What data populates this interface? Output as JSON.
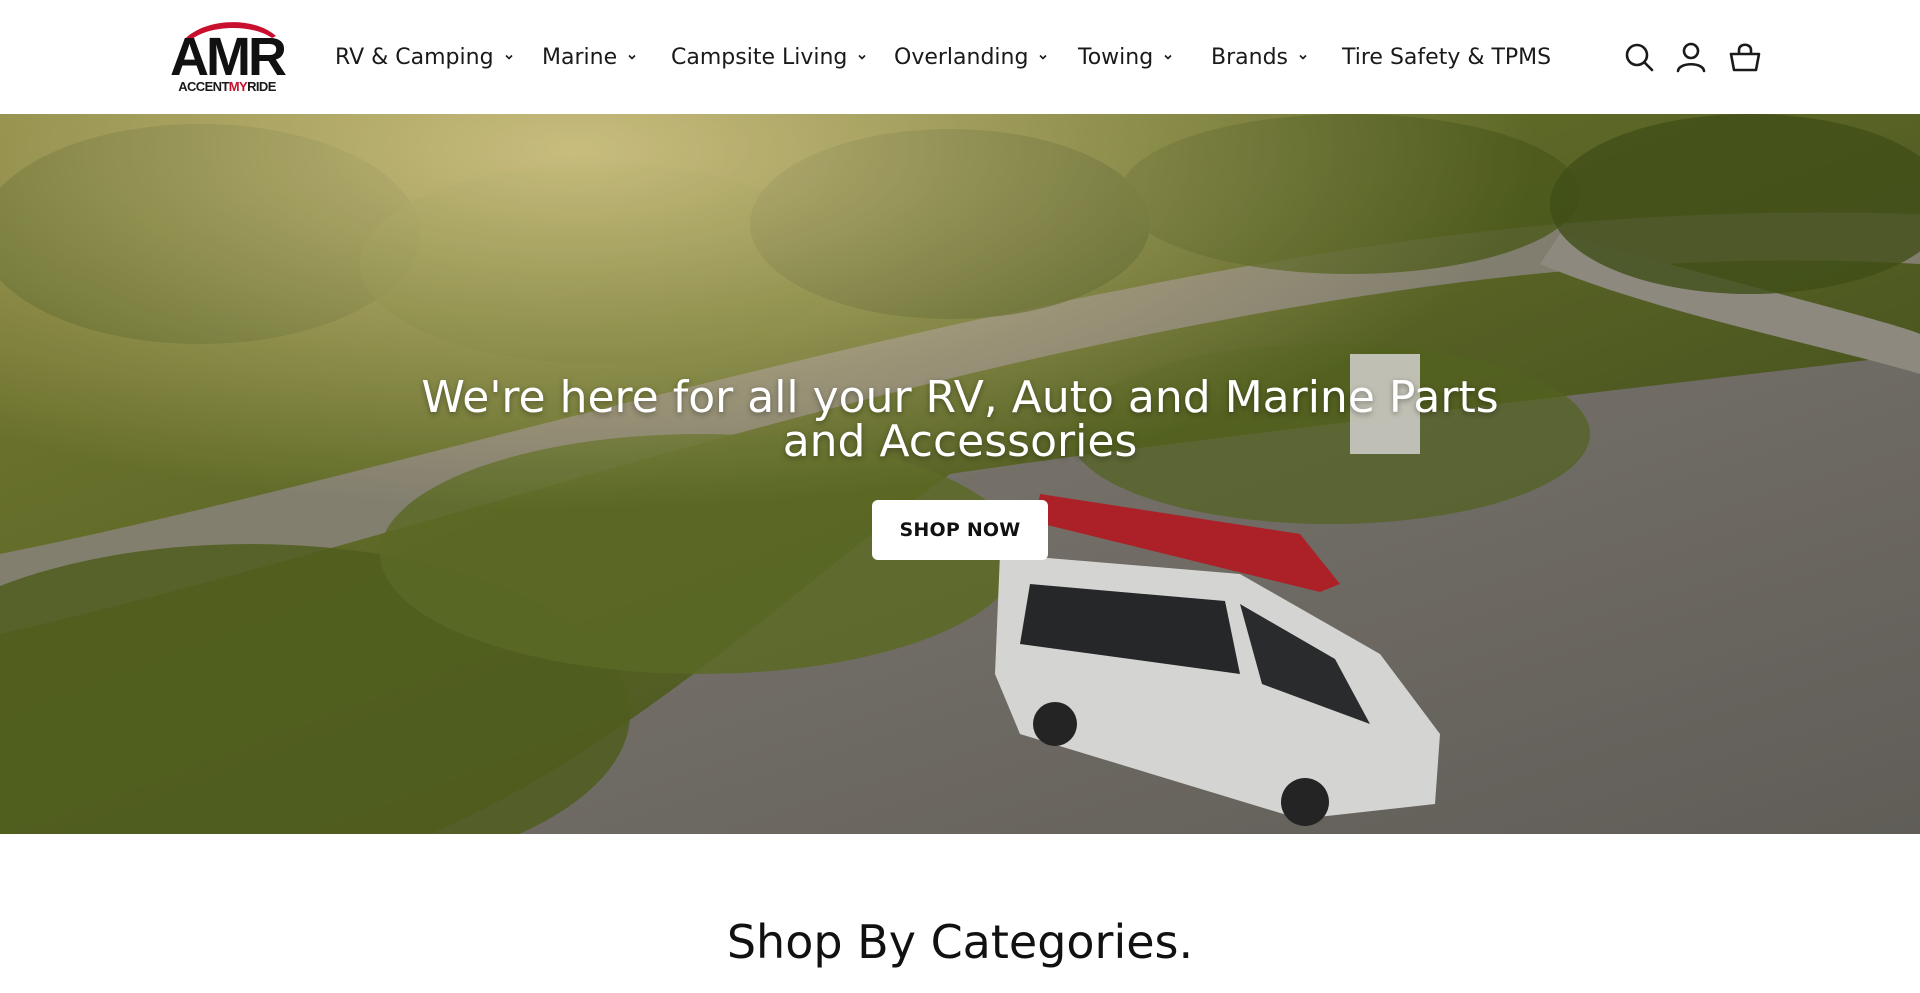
{
  "header": {
    "logo_letters": "AMR",
    "logo_tag_left": "ACCENT",
    "logo_tag_mid": "MY",
    "logo_tag_right": "RIDE",
    "nav": [
      {
        "label": "RV & Camping",
        "has_dropdown": true
      },
      {
        "label": "Marine",
        "has_dropdown": true
      },
      {
        "label": "Campsite Living",
        "has_dropdown": true
      },
      {
        "label": "Overlanding",
        "has_dropdown": true
      },
      {
        "label": "Towing",
        "has_dropdown": true
      },
      {
        "label": "Brands",
        "has_dropdown": true
      },
      {
        "label": "Tire Safety & TPMS",
        "has_dropdown": false
      }
    ],
    "icons": [
      "search-icon",
      "account-icon",
      "cart-icon"
    ]
  },
  "hero": {
    "headline_line1": "We're here for all your RV, Auto and Marine Parts",
    "headline_line2": "and Accessories",
    "cta_label": "SHOP NOW"
  },
  "section": {
    "title": "Shop By Categories."
  },
  "colors": {
    "brand_red": "#c8102e",
    "text_dark": "#1a1a1a",
    "button_bg": "#ffffff"
  }
}
